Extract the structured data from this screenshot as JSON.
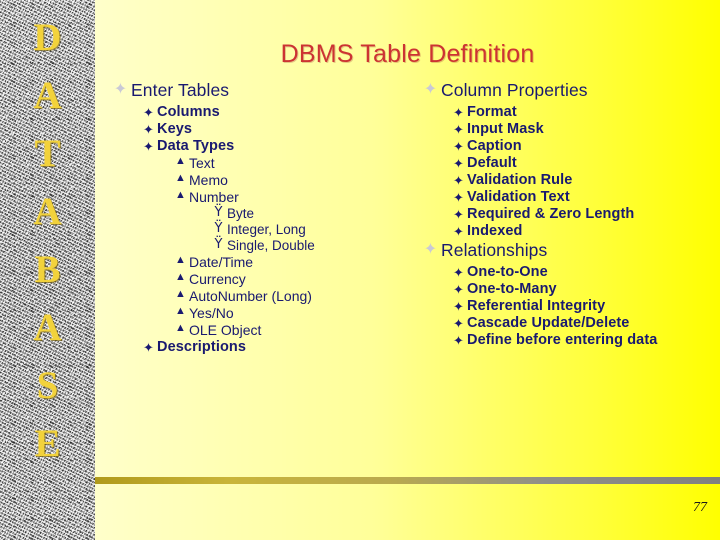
{
  "slide": {
    "title": "DBMS Table Definition",
    "page_number": "77",
    "title_color": "#cc3333",
    "text_color": "#191970",
    "accent_color": "#f2d23b",
    "background_from": "#ffffcc",
    "background_to": "#ffff00"
  },
  "sidebar": {
    "word": "DATABASE",
    "letters": [
      "D",
      "A",
      "T",
      "A",
      "B",
      "A",
      "S",
      "E"
    ]
  },
  "bullets": {
    "level1_glyph": "✦",
    "level2_glyph": "✦",
    "level3_glyph": "▲",
    "level4_glyph": "Ÿ"
  },
  "left_column": [
    {
      "level": 1,
      "text": "Enter Tables"
    },
    {
      "level": 2,
      "text": "Columns"
    },
    {
      "level": 2,
      "text": "Keys"
    },
    {
      "level": 2,
      "text": "Data Types"
    },
    {
      "level": 3,
      "text": "Text"
    },
    {
      "level": 3,
      "text": "Memo"
    },
    {
      "level": 3,
      "text": "Number"
    },
    {
      "level": 4,
      "text": "Byte"
    },
    {
      "level": 4,
      "text": "Integer, Long"
    },
    {
      "level": 4,
      "text": "Single, Double"
    },
    {
      "level": 3,
      "text": "Date/Time"
    },
    {
      "level": 3,
      "text": "Currency"
    },
    {
      "level": 3,
      "text": "AutoNumber (Long)"
    },
    {
      "level": 3,
      "text": "Yes/No"
    },
    {
      "level": 3,
      "text": "OLE Object"
    },
    {
      "level": 2,
      "text": "Descriptions"
    }
  ],
  "right_column": [
    {
      "level": 1,
      "text": "Column Properties"
    },
    {
      "level": 2,
      "text": "Format"
    },
    {
      "level": 2,
      "text": "Input Mask"
    },
    {
      "level": 2,
      "text": "Caption"
    },
    {
      "level": 2,
      "text": "Default"
    },
    {
      "level": 2,
      "text": "Validation Rule"
    },
    {
      "level": 2,
      "text": "Validation Text"
    },
    {
      "level": 2,
      "text": "Required & Zero Length"
    },
    {
      "level": 2,
      "text": "Indexed"
    },
    {
      "level": 1,
      "text": "Relationships"
    },
    {
      "level": 2,
      "text": "One-to-One"
    },
    {
      "level": 2,
      "text": "One-to-Many"
    },
    {
      "level": 2,
      "text": "Referential Integrity"
    },
    {
      "level": 2,
      "text": "Cascade Update/Delete"
    },
    {
      "level": 2,
      "text": "Define before entering data",
      "emphasis": "before"
    }
  ]
}
